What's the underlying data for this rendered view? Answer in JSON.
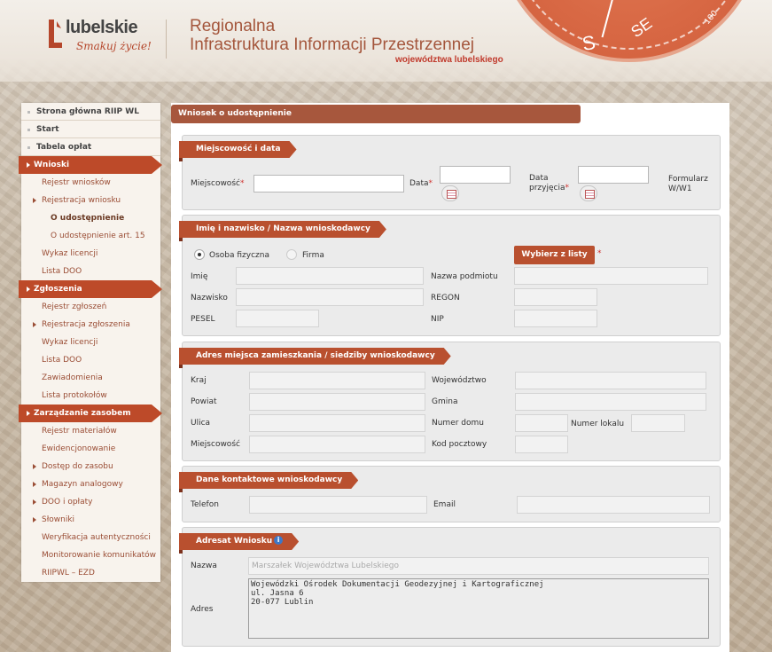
{
  "header": {
    "logo_name": "lubelskie",
    "logo_tagline": "Smakuj życie!",
    "title_line1": "Regionalna",
    "title_line2": "Infrastruktura Informacji Przestrzennej",
    "title_line3": "województwa lubelskiego",
    "compass_s": "S",
    "compass_se": "SE",
    "compass_n1": "220",
    "compass_n2": "100"
  },
  "sidebar": {
    "top_items": [
      "Strona główna RIIP WL",
      "Start",
      "Tabela opłat"
    ],
    "groups": [
      {
        "label": "Wnioski",
        "items": [
          {
            "label": "Rejestr wniosków",
            "arrow": false
          },
          {
            "label": "Rejestracja wniosku",
            "arrow": true
          },
          {
            "label": "O udostępnienie",
            "level2": true,
            "active": true
          },
          {
            "label": "O udostępnienie art. 15",
            "level2": true
          },
          {
            "label": "Wykaz licencji",
            "arrow": false
          },
          {
            "label": "Lista DOO",
            "arrow": false
          }
        ]
      },
      {
        "label": "Zgłoszenia",
        "items": [
          {
            "label": "Rejestr zgłoszeń",
            "arrow": false
          },
          {
            "label": "Rejestracja zgłoszenia",
            "arrow": true
          },
          {
            "label": "Wykaz licencji",
            "arrow": false
          },
          {
            "label": "Lista DOO",
            "arrow": false
          },
          {
            "label": "Zawiadomienia",
            "arrow": false
          },
          {
            "label": "Lista protokołów",
            "arrow": false
          }
        ]
      },
      {
        "label": "Zarządzanie zasobem",
        "items": [
          {
            "label": "Rejestr materiałów",
            "arrow": false
          },
          {
            "label": "Ewidencjonowanie",
            "arrow": false
          },
          {
            "label": "Dostęp do zasobu",
            "arrow": true
          },
          {
            "label": "Magazyn analogowy",
            "arrow": true
          },
          {
            "label": "DOO i opłaty",
            "arrow": true
          },
          {
            "label": "Słowniki",
            "arrow": true
          },
          {
            "label": "Weryfikacja autentyczności",
            "arrow": false
          },
          {
            "label": "Monitorowanie komunikatów",
            "arrow": false
          },
          {
            "label": "RIIPWL – EZD",
            "arrow": false
          }
        ]
      }
    ]
  },
  "main": {
    "title": "Wniosek o udostępnienie",
    "sec1": {
      "heading": "Miejscowość i data",
      "miejscowosc_label": "Miejscowość",
      "data_label": "Data",
      "data_przyjecia_label_1": "Data",
      "data_przyjecia_label_2": "przyjęcia",
      "formularz_1": "Formularz",
      "formularz_2": "W/W1",
      "required_mark": "*"
    },
    "sec2": {
      "heading": "Imię i nazwisko / Nazwa wnioskodawcy",
      "radio_osoba": "Osoba fizyczna",
      "radio_firma": "Firma",
      "select_button": "Wybierz z listy",
      "imie": "Imię",
      "nazwisko": "Nazwisko",
      "pesel": "PESEL",
      "nazwa_podmiotu": "Nazwa podmiotu",
      "regon": "REGON",
      "nip": "NIP"
    },
    "sec3": {
      "heading": "Adres miejsca zamieszkania / siedziby wnioskodawcy",
      "kraj": "Kraj",
      "powiat": "Powiat",
      "ulica": "Ulica",
      "miejscowosc": "Miejscowość",
      "wojewodztwo": "Województwo",
      "gmina": "Gmina",
      "numer_domu": "Numer domu",
      "numer_lokalu": "Numer lokalu",
      "kod_pocztowy": "Kod pocztowy"
    },
    "sec4": {
      "heading": "Dane kontaktowe wnioskodawcy",
      "telefon": "Telefon",
      "email": "Email"
    },
    "sec5": {
      "heading": "Adresat Wniosku",
      "info_icon_glyph": "i",
      "nazwa_label": "Nazwa",
      "nazwa_value": "Marszałek Województwa Lubelskiego",
      "adres_label": "Adres",
      "adres_value": "Wojewódzki Ośrodek Dokumentacji Geodezyjnej i Kartograficznej\nul. Jasna 6\n20-077 Lublin"
    }
  },
  "colors": {
    "accent": "#b9502f",
    "title": "#a4563c",
    "panel": "#ebebeb"
  }
}
